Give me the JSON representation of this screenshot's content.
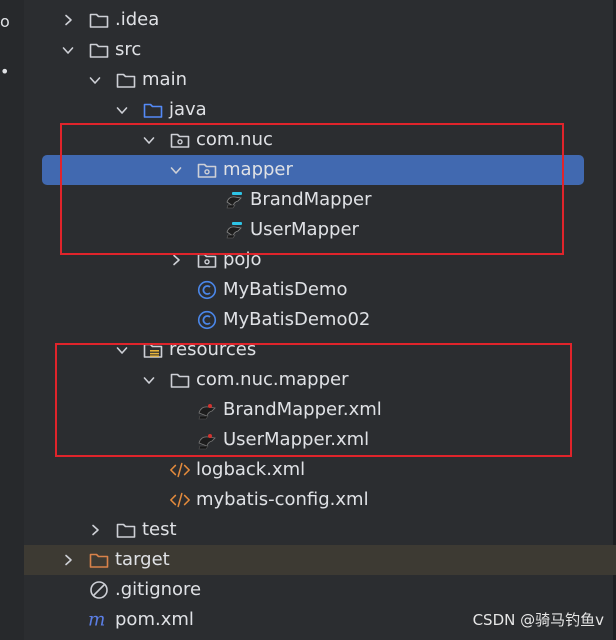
{
  "tree": {
    "items": [
      {
        "id": "idea",
        "label": ".idea",
        "depth": 0,
        "chevron": "right",
        "icon": "folder-icon"
      },
      {
        "id": "src",
        "label": "src",
        "depth": 0,
        "chevron": "down",
        "icon": "folder-icon"
      },
      {
        "id": "main",
        "label": "main",
        "depth": 1,
        "chevron": "down",
        "icon": "folder-icon"
      },
      {
        "id": "java",
        "label": "java",
        "depth": 2,
        "chevron": "down",
        "icon": "source-folder-icon"
      },
      {
        "id": "com-nuc",
        "label": "com.nuc",
        "depth": 3,
        "chevron": "down",
        "icon": "package-icon"
      },
      {
        "id": "mapper",
        "label": "mapper",
        "depth": 4,
        "chevron": "down",
        "icon": "package-icon",
        "selected": true
      },
      {
        "id": "brand-mapper",
        "label": "BrandMapper",
        "depth": 5,
        "chevron": "",
        "icon": "mybatis-mapper-icon"
      },
      {
        "id": "user-mapper",
        "label": "UserMapper",
        "depth": 5,
        "chevron": "",
        "icon": "mybatis-mapper-icon"
      },
      {
        "id": "pojo",
        "label": "pojo",
        "depth": 4,
        "chevron": "right",
        "icon": "package-icon"
      },
      {
        "id": "mybatis-demo",
        "label": "MyBatisDemo",
        "depth": 4,
        "chevron": "",
        "icon": "java-class-icon"
      },
      {
        "id": "mybatis-demo02",
        "label": "MyBatisDemo02",
        "depth": 4,
        "chevron": "",
        "icon": "java-class-icon"
      },
      {
        "id": "resources",
        "label": "resources",
        "depth": 2,
        "chevron": "down",
        "icon": "resources-folder-icon"
      },
      {
        "id": "com-nuc-mapper",
        "label": "com.nuc.mapper",
        "depth": 3,
        "chevron": "down",
        "icon": "folder-icon"
      },
      {
        "id": "brand-mapper-xml",
        "label": "BrandMapper.xml",
        "depth": 4,
        "chevron": "",
        "icon": "mybatis-xml-icon"
      },
      {
        "id": "user-mapper-xml",
        "label": "UserMapper.xml",
        "depth": 4,
        "chevron": "",
        "icon": "mybatis-xml-icon"
      },
      {
        "id": "logback-xml",
        "label": "logback.xml",
        "depth": 3,
        "chevron": "",
        "icon": "xml-file-icon"
      },
      {
        "id": "mybatis-config-xml",
        "label": "mybatis-config.xml",
        "depth": 3,
        "chevron": "",
        "icon": "xml-file-icon"
      },
      {
        "id": "test",
        "label": "test",
        "depth": 1,
        "chevron": "right",
        "icon": "folder-icon"
      },
      {
        "id": "target",
        "label": "target",
        "depth": 0,
        "chevron": "right",
        "icon": "excluded-folder-icon",
        "excluded": true
      },
      {
        "id": "gitignore",
        "label": ".gitignore",
        "depth": 0,
        "chevron": "",
        "icon": "gitignore-icon"
      },
      {
        "id": "pom-xml",
        "label": "pom.xml",
        "depth": 0,
        "chevron": "",
        "icon": "maven-icon"
      }
    ]
  },
  "watermark": "CSDN @骑马钓鱼v",
  "colors": {
    "background": "#2b2d30",
    "selection": "#4169b0",
    "annotation_box": "#e0242b",
    "excluded_row": "#3d3a33",
    "folder_excluded": "#d9824a",
    "java_class": "#4a86e8",
    "xml_file": "#e38a3c"
  }
}
